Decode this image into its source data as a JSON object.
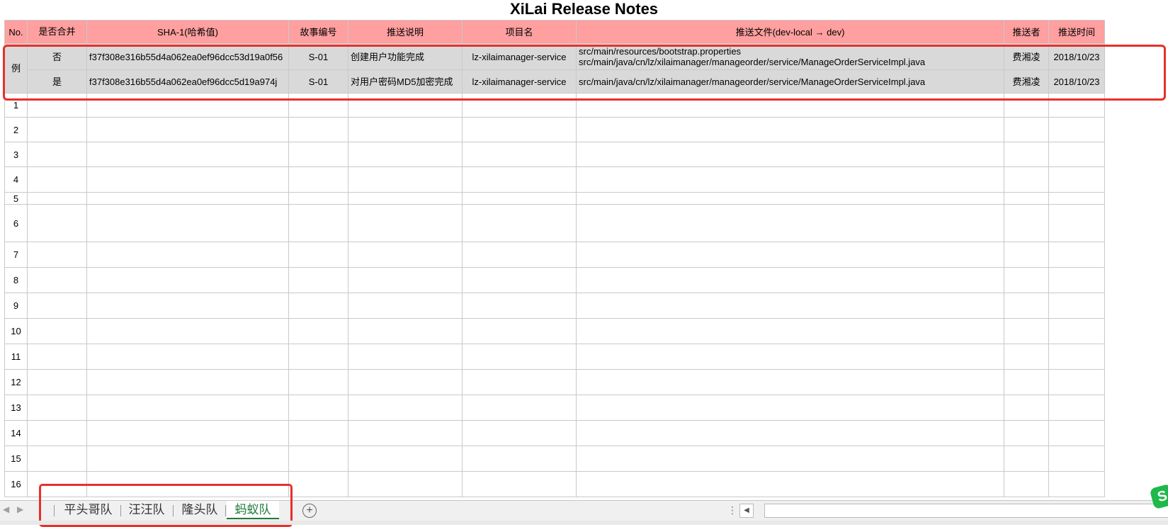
{
  "title": "XiLai Release Notes",
  "headers": {
    "no": "No.",
    "merged": "是否合并",
    "sha": "SHA-1(哈希值)",
    "story": "故事编号",
    "desc": "推送说明",
    "project": "项目名",
    "files": "推送文件(dev-local → dev)",
    "pusher": "推送者",
    "time": "推送时间"
  },
  "example": {
    "label": "例",
    "rows": [
      {
        "merged": "否",
        "sha": "f37f308e316b55d4a062ea0ef96dcc53d19a0f56",
        "story": "S-01",
        "desc": "创建用户功能完成",
        "project": "lz-xilaimanager-service",
        "file1": "src/main/resources/bootstrap.properties",
        "file2": "src/main/java/cn/lz/xilaimanager/manageorder/service/ManageOrderServiceImpl.java",
        "pusher": "费湘凌",
        "time": "2018/10/23"
      },
      {
        "merged": "是",
        "sha": "f37f308e316b55d4a062ea0ef96dcc5d19a974j",
        "story": "S-01",
        "desc": "对用户密码MD5加密完成",
        "project": "lz-xilaimanager-service",
        "file1": "src/main/java/cn/lz/xilaimanager/manageorder/service/ManageOrderServiceImpl.java",
        "file2": "",
        "pusher": "费湘凌",
        "time": "2018/10/23"
      }
    ]
  },
  "row_numbers": [
    "1",
    "2",
    "3",
    "4",
    "5",
    "6",
    "7",
    "8",
    "9",
    "10",
    "11",
    "12",
    "13",
    "14",
    "15",
    "16"
  ],
  "sheet_tabs": [
    "平头哥队",
    "汪汪队",
    "隆头队",
    "蚂蚁队"
  ],
  "active_tab": "蚂蚁队",
  "colors": {
    "header_bg": "#ff9f9f",
    "example_bg": "#d9d9d9",
    "highlight": "#e8302a",
    "active_tab": "#1f7a3a"
  },
  "icons": {
    "add_sheet": "plus-circle-icon",
    "wps": "wps-logo-icon"
  }
}
